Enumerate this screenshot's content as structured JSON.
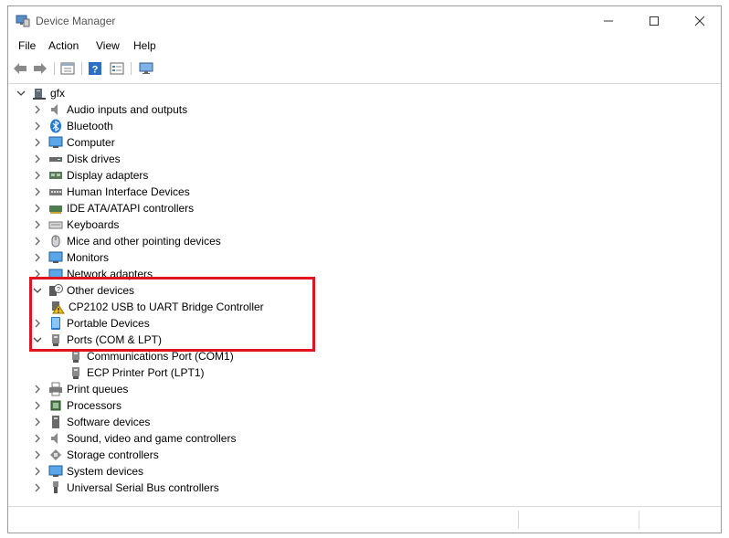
{
  "window": {
    "title": "Device Manager"
  },
  "menu": {
    "file": "File",
    "action": "Action",
    "view": "View",
    "help": "Help"
  },
  "tree": {
    "root": "gfx",
    "items": [
      {
        "label": "Audio inputs and outputs"
      },
      {
        "label": "Bluetooth"
      },
      {
        "label": "Computer"
      },
      {
        "label": "Disk drives"
      },
      {
        "label": "Display adapters"
      },
      {
        "label": "Human Interface Devices"
      },
      {
        "label": "IDE ATA/ATAPI controllers"
      },
      {
        "label": "Keyboards"
      },
      {
        "label": "Mice and other pointing devices"
      },
      {
        "label": "Monitors"
      },
      {
        "label": "Network adapters"
      },
      {
        "label": "Other devices"
      },
      {
        "label": "CP2102 USB to UART Bridge Controller"
      },
      {
        "label": "Portable Devices"
      },
      {
        "label": "Ports (COM & LPT)"
      },
      {
        "label": "Communications Port (COM1)"
      },
      {
        "label": "ECP Printer Port (LPT1)"
      },
      {
        "label": "Print queues"
      },
      {
        "label": "Processors"
      },
      {
        "label": "Software devices"
      },
      {
        "label": "Sound, video and game controllers"
      },
      {
        "label": "Storage controllers"
      },
      {
        "label": "System devices"
      },
      {
        "label": "Universal Serial Bus controllers"
      }
    ]
  },
  "colors": {
    "highlight": "#e0141e",
    "accent": "#1e7ad8"
  }
}
